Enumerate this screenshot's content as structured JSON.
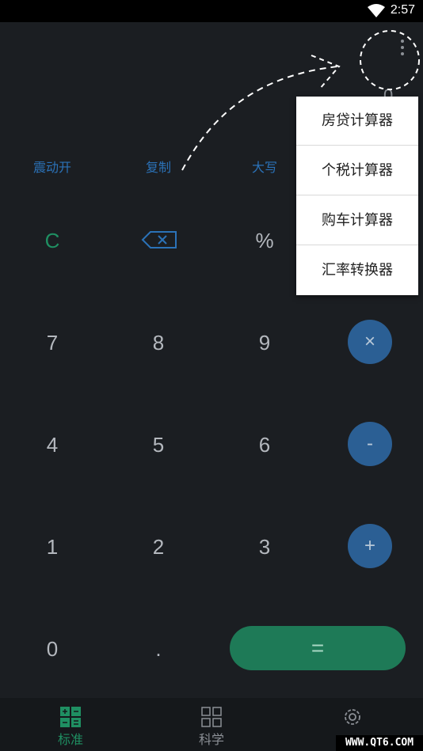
{
  "status_bar": {
    "time": "2:57",
    "wifi_icon": "wifi-icon"
  },
  "function_row": {
    "vibrate": "震动开",
    "copy": "复制",
    "uppercase": "大写"
  },
  "keypad": {
    "clear": "C",
    "backspace_icon": "backspace-icon",
    "percent": "%",
    "seven": "7",
    "eight": "8",
    "nine": "9",
    "multiply": "×",
    "four": "4",
    "five": "5",
    "six": "6",
    "minus": "-",
    "one": "1",
    "two": "2",
    "three": "3",
    "plus": "+",
    "zero": "0",
    "dot": ".",
    "equals": "="
  },
  "display_partial": "0",
  "overflow_menu": {
    "icon": "more-vert-icon",
    "items": [
      "房贷计算器",
      "个税计算器",
      "购车计算器",
      "汇率转换器"
    ]
  },
  "bottom_nav": {
    "items": [
      {
        "label": "标准",
        "icon": "standard-calculator-icon",
        "active": true
      },
      {
        "label": "科学",
        "icon": "scientific-calculator-icon",
        "active": false
      },
      {
        "label": "",
        "icon": "settings-icon",
        "active": false
      }
    ]
  },
  "watermark": "WWW.QT6.COM",
  "colors": {
    "background": "#1b1e22",
    "accent_green": "#1f8f62",
    "accent_blue": "#2b72b8",
    "operator_circle": "#2b5f94"
  }
}
